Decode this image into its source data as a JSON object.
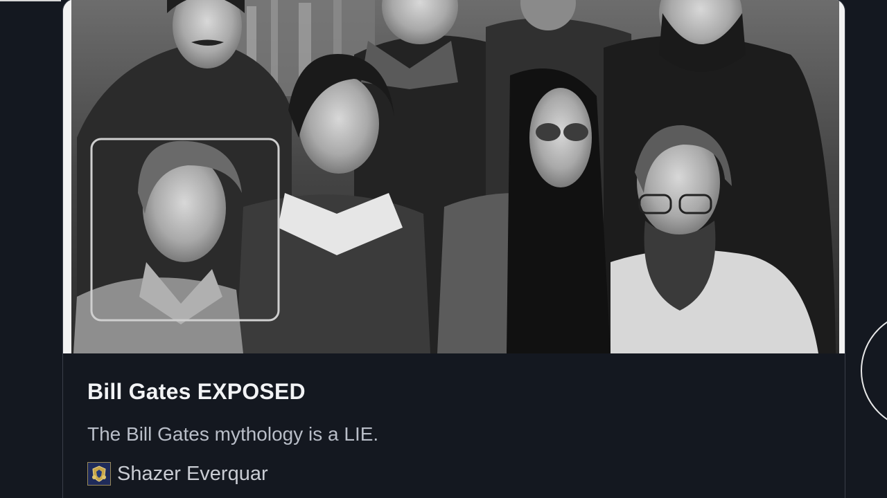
{
  "card": {
    "image_alt": "Black-and-white group photo of eleven people with one person highlighted by a rounded rectangle",
    "title": "Bill Gates EXPOSED",
    "description": "The Bill Gates mythology is a LIE.",
    "author": {
      "name": "Shazer Everquar",
      "avatar_icon": "crest-avatar-icon"
    }
  },
  "controls": {
    "next_icon": "chevron-right-circle-icon"
  },
  "colors": {
    "background": "#141820",
    "title": "#f2f3f5",
    "description": "#b9bec8",
    "card_border": "#3a3f49"
  }
}
